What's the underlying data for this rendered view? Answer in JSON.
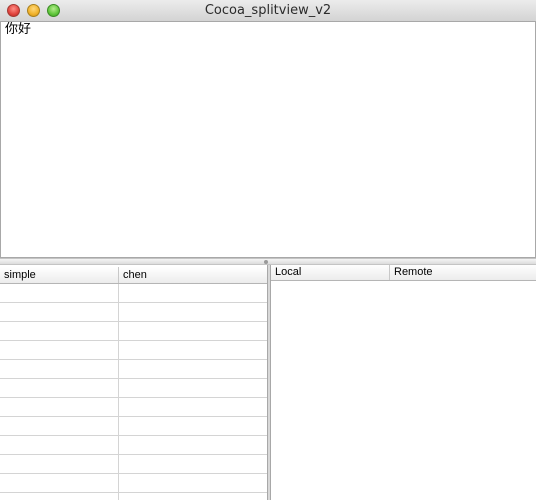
{
  "window": {
    "title": "Cocoa_splitview_v2"
  },
  "text_view": {
    "content": "你好"
  },
  "left_table": {
    "columns": [
      "simple",
      "chen"
    ],
    "row_count": 12
  },
  "right_table": {
    "columns": [
      "Local",
      "Remote"
    ]
  },
  "colors": {
    "close": "#e0443e",
    "minimize": "#f0b22b",
    "zoom": "#5fc63a"
  }
}
